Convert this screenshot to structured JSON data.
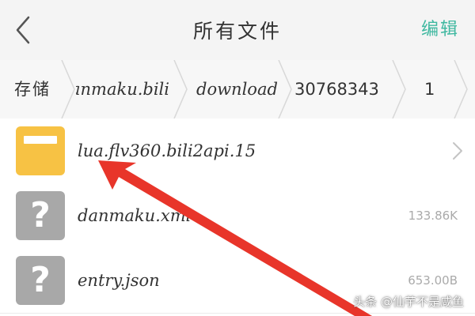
{
  "header": {
    "title": "所有文件",
    "edit_label": "编辑"
  },
  "breadcrumb": {
    "items": [
      "存储",
      "danmaku.bili",
      "download",
      "30768343",
      "1"
    ]
  },
  "files": [
    {
      "name": "lua.flv360.bili2api.15",
      "size": "",
      "type": "folder",
      "icon": "folder-icon"
    },
    {
      "name": "danmaku.xml",
      "size": "133.86K",
      "type": "unknown",
      "icon": "question-mark-icon"
    },
    {
      "name": "entry.json",
      "size": "653.00B",
      "type": "unknown",
      "icon": "question-mark-icon"
    }
  ],
  "watermark": "头条 @仙芋不是咸鱼",
  "colors": {
    "accent": "#3fb8a0",
    "folder": "#f7c244",
    "unknown_icon": "#a8a8a8",
    "arrow": "#e8352a"
  }
}
